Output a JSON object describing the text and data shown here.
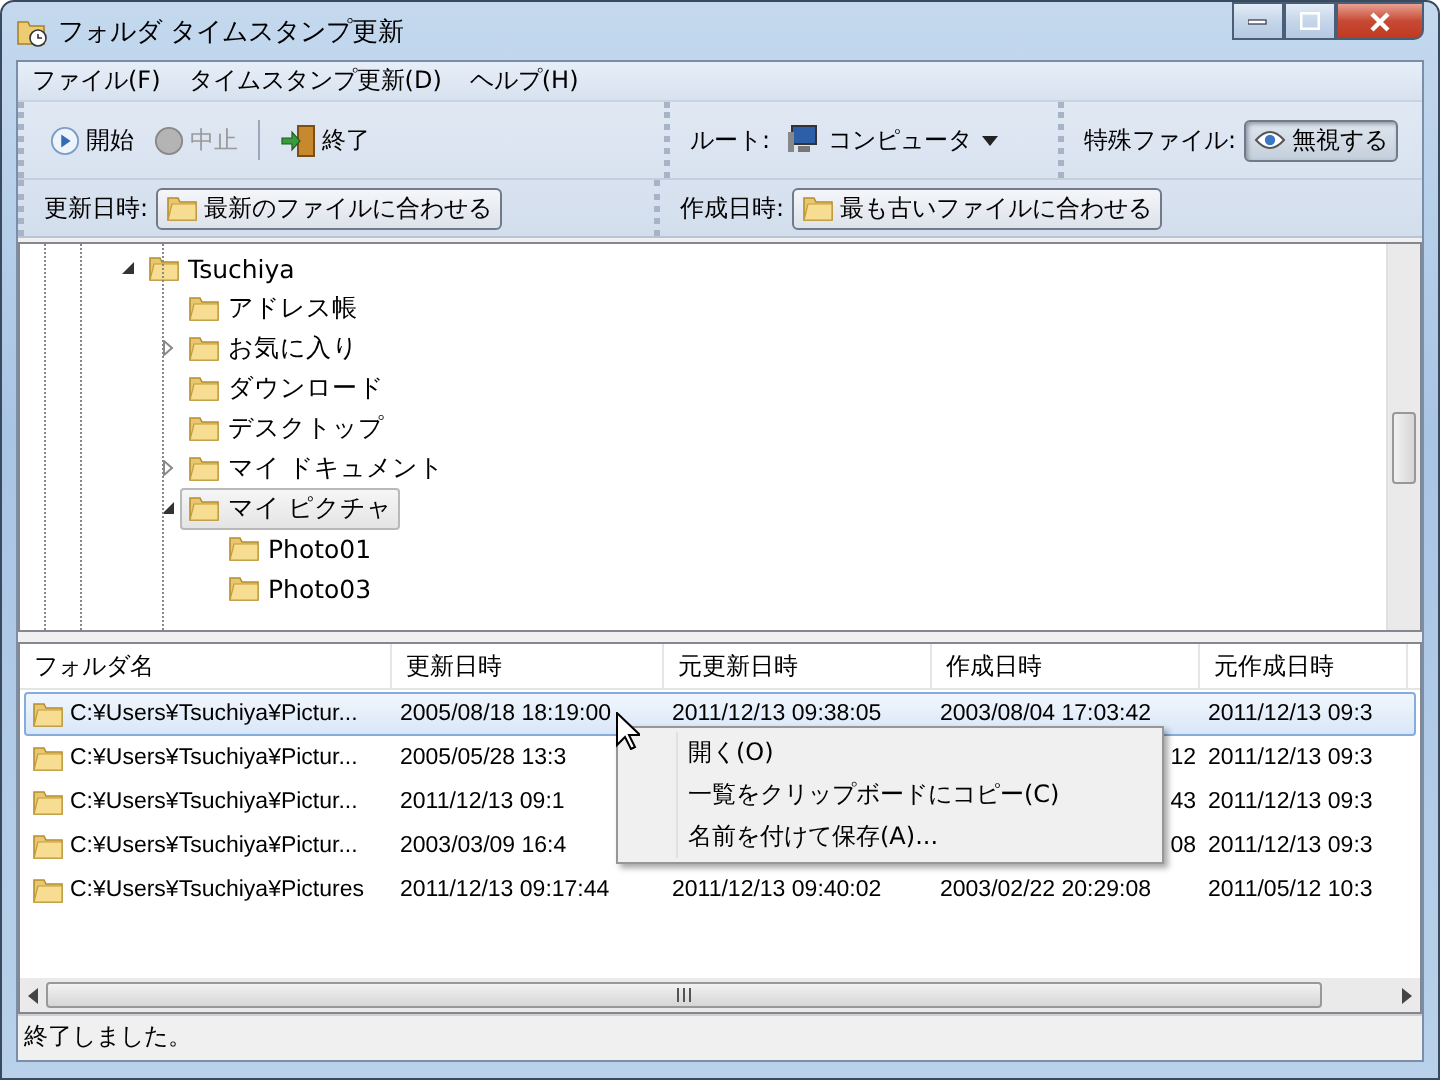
{
  "window": {
    "title": "フォルダ タイムスタンプ更新"
  },
  "menu": [
    "ファイル(F)",
    "タイムスタンプ更新(D)",
    "ヘルプ(H)"
  ],
  "toolbar": {
    "start": {
      "label": "開始",
      "disabled": false
    },
    "stop": {
      "label": "中止",
      "disabled": true
    },
    "exit": {
      "label": "終了",
      "disabled": false
    },
    "root_label": "ルート:",
    "root_value": "コンピュータ",
    "special_label": "特殊ファイル:",
    "special_button": {
      "label": "無視する",
      "selected": true
    },
    "modified_label": "更新日時:",
    "modified_button": "最新のファイルに合わせる",
    "created_label": "作成日時:",
    "created_button": "最も古いファイルに合わせる"
  },
  "tree": [
    {
      "label": "Tsuchiya",
      "kind": "branch",
      "expanded": true,
      "selected": false,
      "children": [
        {
          "label": "アドレス帳",
          "selected": false
        },
        {
          "label": "お気に入り",
          "kind": "branch",
          "expanded": false,
          "selected": false
        },
        {
          "label": "ダウンロード",
          "selected": false
        },
        {
          "label": "デスクトップ",
          "selected": false
        },
        {
          "label": "マイ ドキュメント",
          "kind": "branch",
          "expanded": false,
          "selected": false
        },
        {
          "label": "マイ ピクチャ",
          "kind": "branch",
          "expanded": true,
          "selected": true,
          "children": [
            {
              "label": "Photo01",
              "selected": false
            },
            {
              "label": "Photo03",
              "selected": false
            }
          ]
        }
      ]
    }
  ],
  "list": {
    "columns": [
      "フォルダ名",
      "更新日時",
      "元更新日時",
      "作成日時",
      "元作成日時"
    ],
    "rows": [
      {
        "selected": true,
        "name": "C:¥Users¥Tsuchiya¥Pictur...",
        "modified": "2005/08/18 18:19:00",
        "orig_modified": "2011/12/13 09:38:05",
        "created": "2003/08/04 17:03:42",
        "orig_created": "2011/12/13 09:3"
      },
      {
        "selected": false,
        "name": "C:¥Users¥Tsuchiya¥Pictur...",
        "modified": "2005/05/28 13:3",
        "created_tail": "12",
        "orig_created": "2011/12/13 09:3"
      },
      {
        "selected": false,
        "name": "C:¥Users¥Tsuchiya¥Pictur...",
        "modified": "2011/12/13 09:1",
        "created_tail": "43",
        "orig_created": "2011/12/13 09:3"
      },
      {
        "selected": false,
        "name": "C:¥Users¥Tsuchiya¥Pictur...",
        "modified": "2003/03/09 16:4",
        "created_tail": "08",
        "orig_created": "2011/12/13 09:3"
      },
      {
        "selected": false,
        "name": "C:¥Users¥Tsuchiya¥Pictures",
        "modified": "2011/12/13 09:17:44",
        "orig_modified": "2011/12/13 09:40:02",
        "created": "2003/02/22 20:29:08",
        "orig_created": "2011/05/12 10:3"
      }
    ]
  },
  "context_menu": [
    "開く(O)",
    "一覧をクリップボードにコピー(C)",
    "名前を付けて保存(A)..."
  ],
  "status": "終了しました。"
}
